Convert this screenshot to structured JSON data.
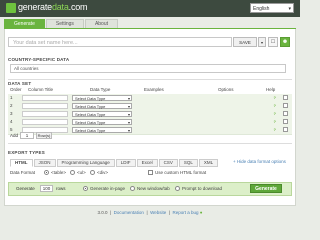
{
  "header": {
    "logo_main": "generate",
    "logo_accent": "data",
    "logo_suffix": ".com",
    "language": "English"
  },
  "tabs": [
    {
      "label": "Generate",
      "active": true
    },
    {
      "label": "Settings",
      "active": false
    },
    {
      "label": "About",
      "active": false
    }
  ],
  "title_input": {
    "placeholder": "Your data set name here..."
  },
  "save_label": "SAVE",
  "country": {
    "section_label": "COUNTRY-SPECIFIC DATA",
    "selected": "All countries"
  },
  "dataset": {
    "section_label": "DATA SET",
    "columns": {
      "order": "Order",
      "column_title": "Column Title",
      "data_type": "Data Type",
      "examples": "Examples",
      "options": "Options",
      "help": "Help"
    },
    "rows": [
      {
        "num": "1",
        "type": "Select Data Type"
      },
      {
        "num": "2",
        "type": "Select Data Type"
      },
      {
        "num": "3",
        "type": "Select Data Type"
      },
      {
        "num": "4",
        "type": "Select Data Type"
      },
      {
        "num": "5",
        "type": "Select Data Type"
      }
    ],
    "help_symbol": "?",
    "add_label": "Add",
    "add_count": "1",
    "add_button": "Row(s)"
  },
  "export": {
    "section_label": "EXPORT TYPES",
    "tabs": [
      "HTML",
      "JSON",
      "Programming Language",
      "LDIF",
      "Excel",
      "CSV",
      "SQL",
      "XML"
    ],
    "active_tab": "HTML",
    "hide_link": "+ Hide data format options",
    "format_label": "Data Format",
    "formats": [
      "<table>",
      "<ul>",
      "<div>"
    ],
    "custom_label": "Use custom HTML format"
  },
  "generate": {
    "label": "Generate",
    "count": "100",
    "rows_label": "rows",
    "options": [
      "Generate in-page",
      "New window/tab",
      "Prompt to download"
    ],
    "button": "Generate"
  },
  "footer": {
    "version": "3.0.0",
    "links": [
      "Documentation",
      "Website",
      "Report a bug"
    ]
  },
  "colors": {
    "accent": "#6ab43e",
    "header": "#3d4a3f"
  }
}
